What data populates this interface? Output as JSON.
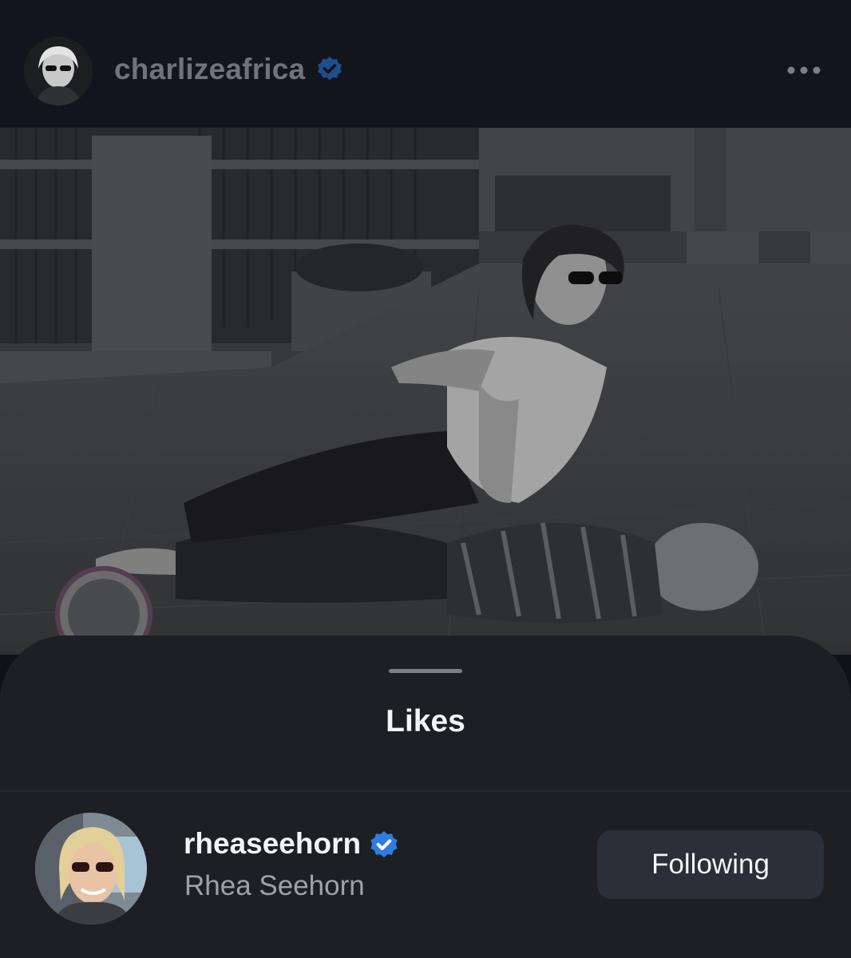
{
  "post": {
    "author_username": "charlizeafrica",
    "author_verified": true,
    "more_icon": "more-horizontal-icon"
  },
  "likes_sheet": {
    "title": "Likes",
    "likes": [
      {
        "username": "rheaseehorn",
        "verified": true,
        "full_name": "Rhea Seehorn",
        "button_label": "Following"
      }
    ]
  },
  "colors": {
    "background": "#0f1217",
    "sheet": "#1d1f25",
    "verified_blue": "#2f7de1",
    "button": "#2b2f37"
  }
}
